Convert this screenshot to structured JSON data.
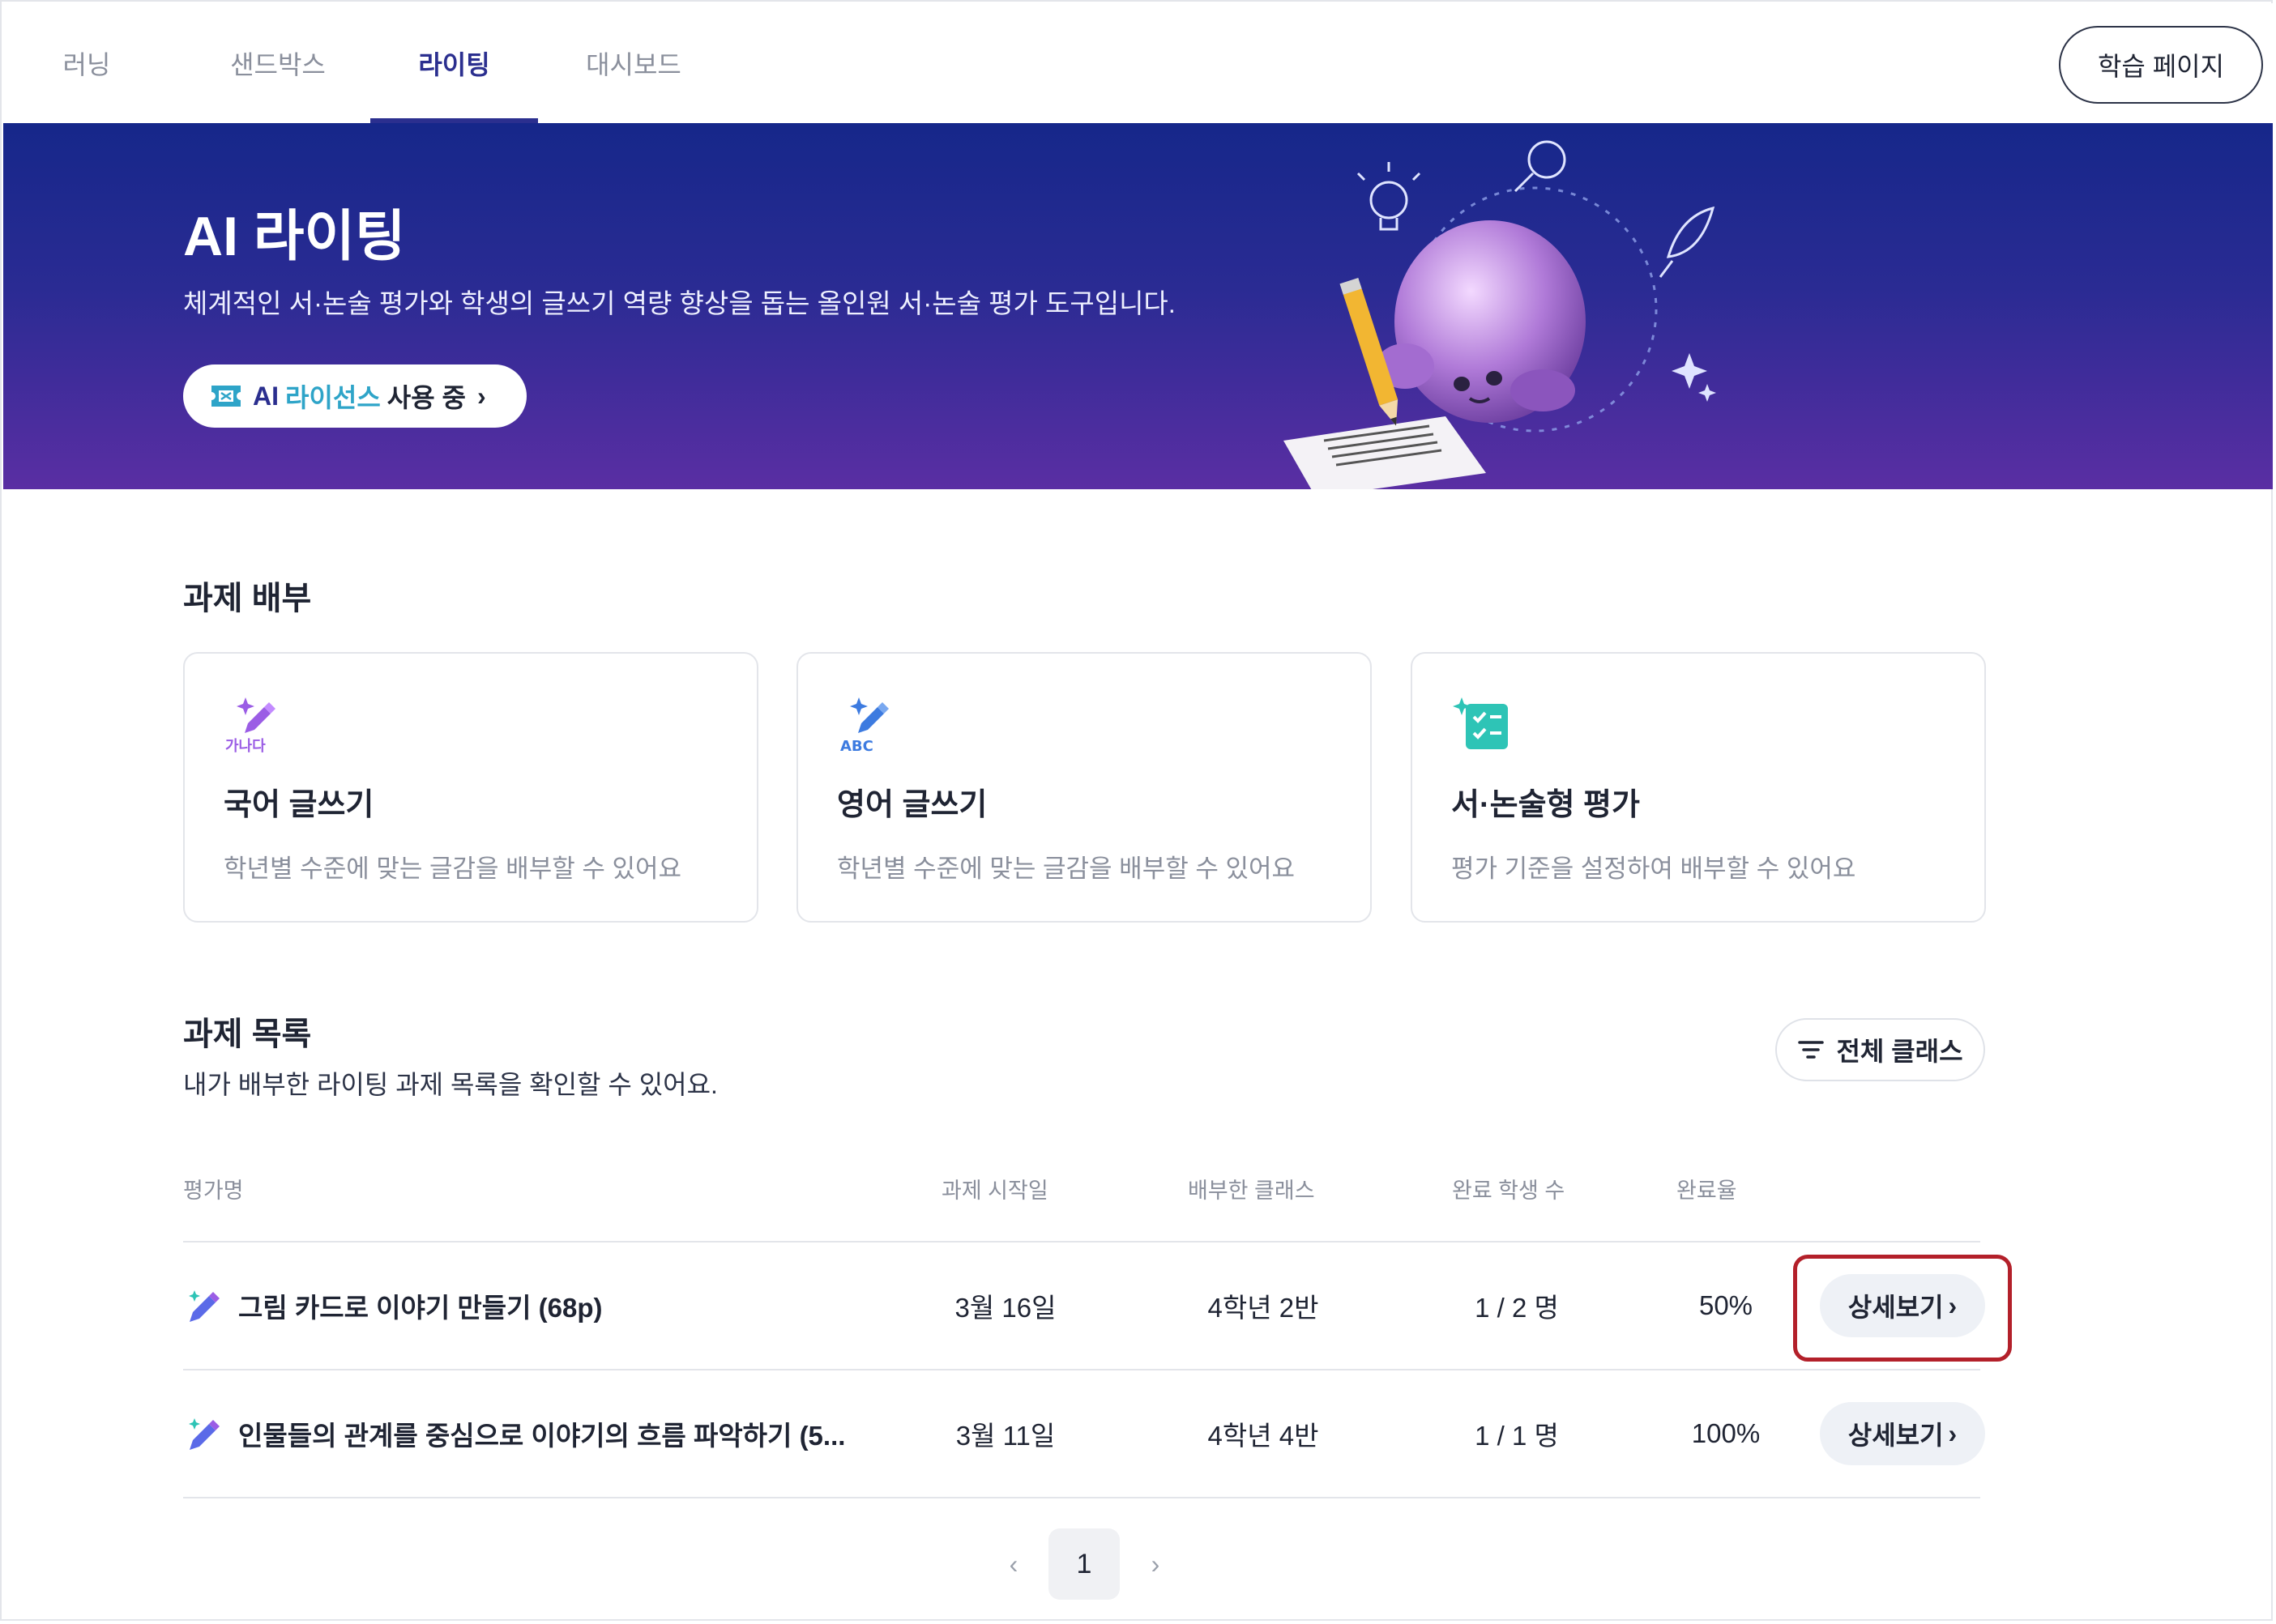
{
  "nav": {
    "tabs": [
      {
        "label": "러닝",
        "active": false
      },
      {
        "label": "샌드박스",
        "active": false
      },
      {
        "label": "라이팅",
        "active": true
      },
      {
        "label": "대시보드",
        "active": false
      }
    ],
    "learn_page_label": "학습 페이지"
  },
  "banner": {
    "title": "AI 라이팅",
    "subtitle": "체계적인 서·논술 평가와 학생의 글쓰기 역량 향상을 돕는 올인원 서·논술 평가 도구입니다.",
    "license": {
      "ai": "AI",
      "license": "라이선스",
      "status": "사용 중",
      "chevron": "›"
    }
  },
  "assign": {
    "title": "과제 배부",
    "cards": [
      {
        "icon": "pen-sparkle-korean-icon",
        "badge": "가나다",
        "title": "국어 글쓰기",
        "desc": "학년별 수준에 맞는 글감을 배부할 수 있어요"
      },
      {
        "icon": "pen-sparkle-english-icon",
        "badge": "ABC",
        "title": "영어 글쓰기",
        "desc": "학년별 수준에 맞는 글감을 배부할 수 있어요"
      },
      {
        "icon": "checklist-sparkle-icon",
        "badge": "",
        "title": "서·논술형 평가",
        "desc": "평가 기준을 설정하여 배부할 수 있어요"
      }
    ]
  },
  "list": {
    "title": "과제 목록",
    "subtitle": "내가 배부한 라이팅 과제 목록을 확인할 수 있어요.",
    "filter_label": "전체 클래스",
    "columns": [
      "평가명",
      "과제 시작일",
      "배부한 클래스",
      "완료 학생 수",
      "완료율"
    ],
    "rows": [
      {
        "name": "그림 카드로 이야기 만들기 (68p)",
        "start": "3월 16일",
        "class": "4학년 2반",
        "done": "1 / 2 명",
        "rate": "50%",
        "action": "상세보기"
      },
      {
        "name": "인물들의 관계를 중심으로 이야기의 흐름 파악하기 (5...",
        "start": "3월 11일",
        "class": "4학년 4반",
        "done": "1 / 1 명",
        "rate": "100%",
        "action": "상세보기"
      }
    ]
  },
  "pagination": {
    "current": "1",
    "prev": "‹",
    "next": "›"
  },
  "colors": {
    "accent": "#2b2f8f",
    "highlight": "#b3202a",
    "banner_top": "#16278a",
    "banner_bottom": "#5a2ea3"
  }
}
